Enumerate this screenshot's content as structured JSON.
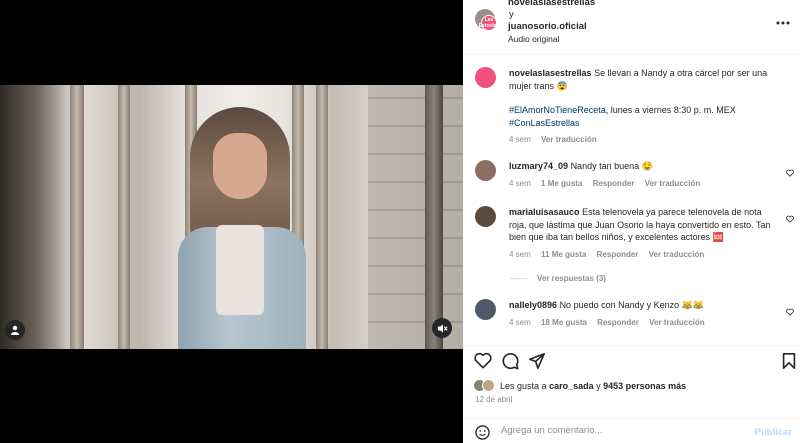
{
  "header": {
    "account1": "novelaslasestrellas",
    "connector": "y",
    "account2": "juanosorio.oficial",
    "audio": "Audio original",
    "more_icon": "more-horizontal-icon"
  },
  "brand_avatar_text": "Las Estrellas",
  "caption": {
    "user": "novelaslasestrellas",
    "text": "Se llevan a Nandy a otra cárcel por ser una mujer trans 😨",
    "hashtag1": "#ElAmorNoTieneReceta",
    "schedule": ", lunes a viernes 8:30 p. m. MEX",
    "hashtag2": "#ConLasEstrellas",
    "time": "4 sem",
    "translate": "Ver traducción"
  },
  "comments": [
    {
      "user": "luzmary74_09",
      "text": "Nandy tan buena 🤤",
      "time": "4 sem",
      "likes": "1 Me gusta",
      "reply": "Responder",
      "translate": "Ver traducción"
    },
    {
      "user": "marialuisasauco",
      "text": "Esta telenovela ya parece telenovela de nota roja, que lástima que Juan Osorio la haya convertido en esto. Tan bien que iba tan bellos niños, y excelentes actores 🆘",
      "time": "4 sem",
      "likes": "11 Me gusta",
      "reply": "Responder",
      "translate": "Ver traducción",
      "view_replies": "Ver respuestas (3)"
    },
    {
      "user": "nallely0896",
      "text": "No puedo con Nandy y Kenzo 😹😹",
      "time": "4 sem",
      "likes": "18 Me gusta",
      "reply": "Responder",
      "translate": "Ver traducción"
    }
  ],
  "likes": {
    "prefix": "Les gusta a",
    "user": "caro_sada",
    "middle": "y",
    "count": "9453 personas más"
  },
  "date": "12 de abril",
  "composer": {
    "placeholder": "Agrega un comentario...",
    "post": "Publicar"
  },
  "colors": {
    "accent": "#f2527a",
    "link": "#00376b",
    "muted": "#8e8e8e",
    "post_disabled": "#b3dbff"
  }
}
